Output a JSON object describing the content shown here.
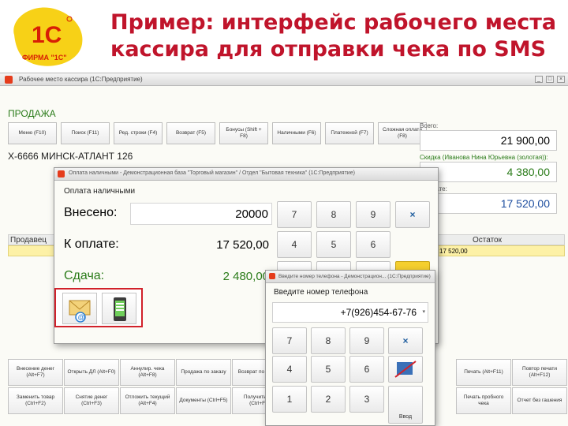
{
  "slide": {
    "title_line1": "Пример: интерфейс рабочего места",
    "title_line2": "кассира для отправки чека по SMS"
  },
  "logo": {
    "brand": "1С",
    "caption": "ФИРМА \"1С\""
  },
  "colors": {
    "title": "#c0142b",
    "accent_green": "#2a7b19",
    "accent_blue": "#1f5d9e",
    "highlight": "#d1212a"
  },
  "app": {
    "title": "Рабочее место кассира (1С:Предприятие)",
    "mode_label": "ПРОДАЖА",
    "item_name": "Х-6666 МИНСК-АТЛАНТ 126",
    "function_buttons": [
      "Меню (F10)",
      "Поиск (F11)",
      "Ред. строки (F4)",
      "Возврат (F5)",
      "Бонусы (Shift + F8)",
      "Наличными (F6)",
      "Платежной (F7)",
      "Сложная оплата (F8)"
    ],
    "totals": {
      "sum_label": "Всего:",
      "sum_value": "21 900,00",
      "discount_label": "Скидка (Иванова Нина Юрьевна (золотая)):",
      "discount_value": "4 380,00",
      "topay_label": "К оплате:",
      "topay_value": "17 520,00"
    },
    "grid": {
      "col_seller": "Продавец",
      "col_rest": "Остаток",
      "row_value": "17 520,00"
    },
    "bottom_buttons": [
      "Внесение денег (Alt+F7)",
      "Открыть ДЛ (Alt+F0)",
      "Аннулир. чека (Alt+F8)",
      "Продажа по заказу",
      "Возврат по заказу",
      "",
      "",
      "",
      "Печать (Alt+F11)",
      "Повтор печати (Alt+F12)",
      "Заменить товар (Ctrl+F2)",
      "Снятие денег (Ctrl+F3)",
      "Отложить текущий (Alt+F4)",
      "Документы (Ctrl+F5)",
      "Получить чек (Ctrl+F6)",
      "",
      "",
      "",
      "Печать пробного чека",
      "Отчет без гашения"
    ]
  },
  "payment_dialog": {
    "title": "Оплата наличными - Демонстрационная база \"Торговый магазин\" / Отдел \"Бытовая техника\" (1С:Предприятие)",
    "heading": "Оплата наличными",
    "paid_label": "Внесено:",
    "paid_value": "20000",
    "topay_label": "К оплате:",
    "topay_value": "17 520,00",
    "change_label": "Сдача:",
    "change_value": "2 480,00",
    "keypad": [
      "7",
      "8",
      "9",
      "×",
      "4",
      "5",
      "6",
      "1",
      "2",
      "3"
    ]
  },
  "phone_dialog": {
    "title": "Введите номер телефона - Демонстрацион... (1С:Предприятие)",
    "heading": "Введите номер телефона",
    "phone_value": "+7(926)454-67-76",
    "keypad": [
      "7",
      "8",
      "9",
      "×",
      "4",
      "5",
      "6",
      "1",
      "2",
      "3"
    ],
    "enter_label": "Ввод"
  }
}
